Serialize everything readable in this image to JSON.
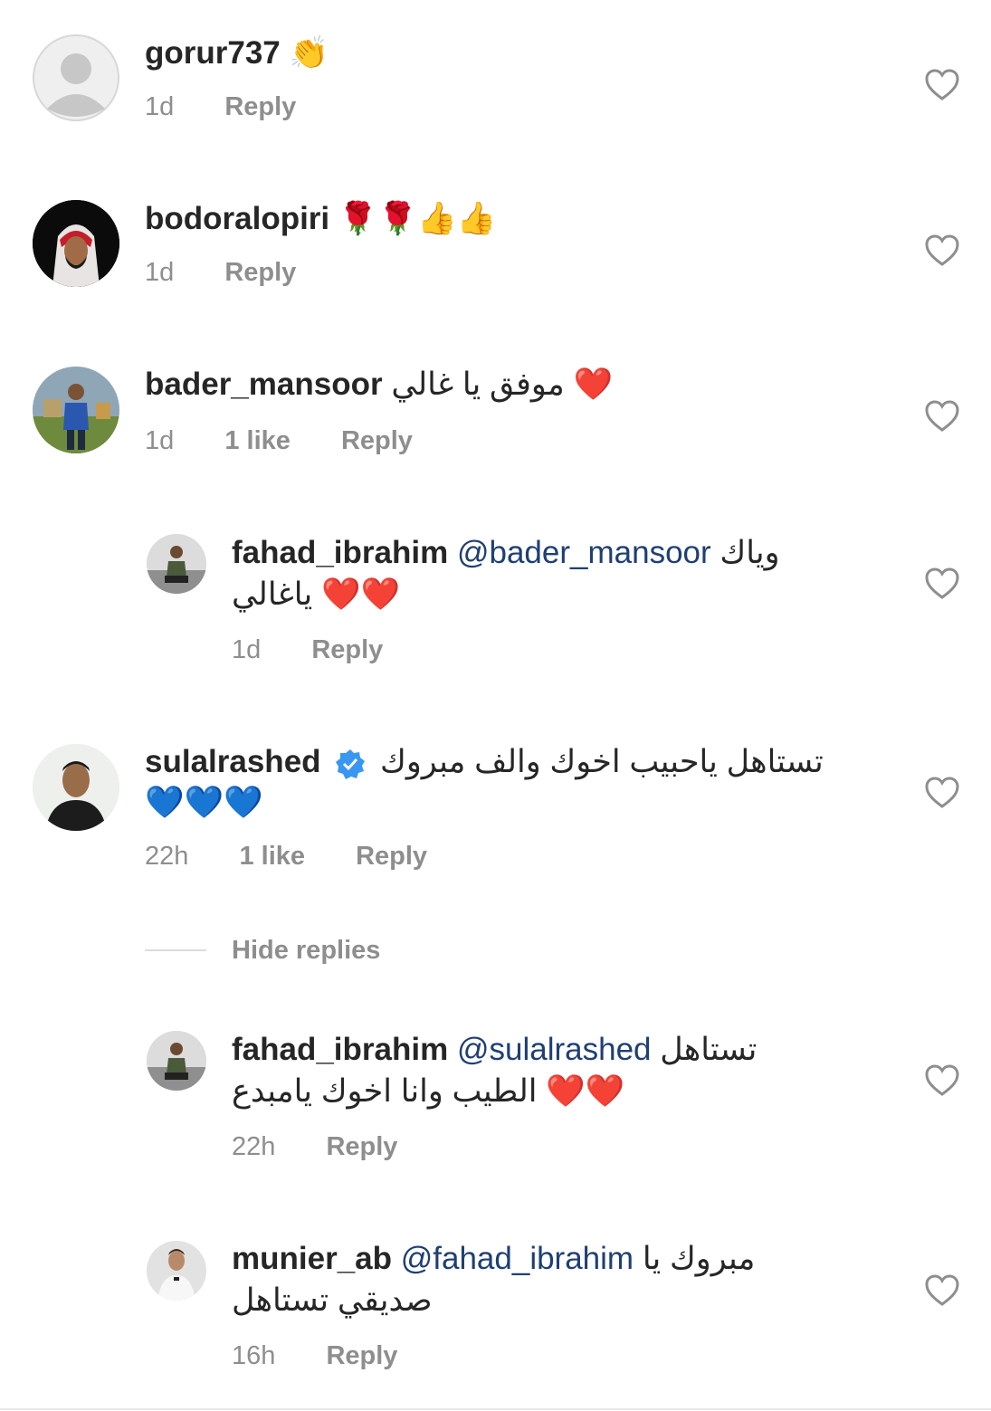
{
  "comments": [
    {
      "username": "gorur737",
      "text": "",
      "emoji": "👏",
      "time": "1d",
      "likes": "",
      "reply": "Reply"
    },
    {
      "username": "bodoralopiri",
      "text": "",
      "emoji": "🌹🌹👍👍",
      "time": "1d",
      "likes": "",
      "reply": "Reply"
    },
    {
      "username": "bader_mansoor",
      "text": "موفق يا غالي",
      "emoji": "❤️",
      "time": "1d",
      "likes": "1 like",
      "reply": "Reply"
    },
    {
      "username": "fahad_ibrahim",
      "mention": "@bader_mansoor",
      "text": "وياك",
      "text2": "ياغالي",
      "emoji": "❤️❤️",
      "time": "1d",
      "likes": "",
      "reply": "Reply"
    },
    {
      "username": "sulalrashed",
      "verified": true,
      "text": "تستاهل ياحبيب اخوك والف مبروك",
      "emoji": "💙💙💙",
      "time": "22h",
      "likes": "1 like",
      "reply": "Reply"
    },
    {
      "username": "fahad_ibrahim",
      "mention": "@sulalrashed",
      "text": "تستاهل",
      "text2": "الطيب وانا اخوك يامبدع",
      "emoji": "❤️❤️",
      "time": "22h",
      "likes": "",
      "reply": "Reply"
    },
    {
      "username": "munier_ab",
      "mention": "@fahad_ibrahim",
      "text": "مبروك يا",
      "text2": "صديقي تستاهل",
      "time": "16h",
      "likes": "",
      "reply": "Reply"
    }
  ],
  "hide_replies": "Hide replies",
  "icons": {
    "heart": "heart-outline-icon",
    "verified": "verified-badge-icon"
  },
  "colors": {
    "mention": "#1f3f73",
    "meta": "#8e8e8e",
    "verified": "#3897f0"
  }
}
